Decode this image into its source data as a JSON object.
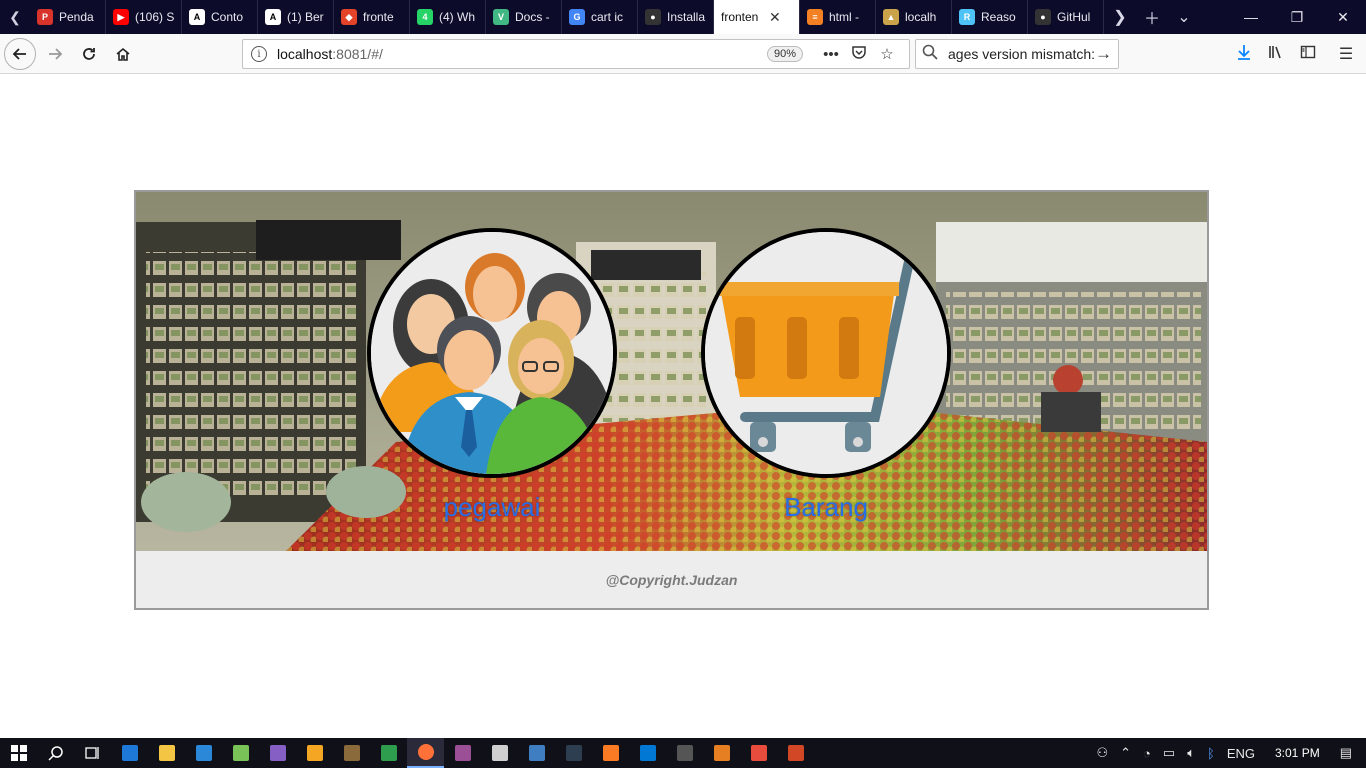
{
  "browser": {
    "tabs": [
      {
        "title": "Penda",
        "icon": "pmb-icon",
        "color": "#d9342b",
        "glyph": "P"
      },
      {
        "title": "(106) S",
        "icon": "youtube-icon",
        "color": "#ff0000",
        "glyph": "▶"
      },
      {
        "title": "Conto",
        "icon": "notion-icon",
        "color": "#ffffff",
        "glyph": "A"
      },
      {
        "title": "(1) Ber",
        "icon": "font-a-icon",
        "color": "#ffffff",
        "glyph": "A"
      },
      {
        "title": "fronte",
        "icon": "gitlab-icon",
        "color": "#e24329",
        "glyph": "◆"
      },
      {
        "title": "(4) Wh",
        "icon": "whatsapp-icon",
        "color": "#25d366",
        "glyph": "4"
      },
      {
        "title": "Docs -",
        "icon": "vue-icon",
        "color": "#41b883",
        "glyph": "V"
      },
      {
        "title": "cart ic",
        "icon": "google-icon",
        "color": "#4285f4",
        "glyph": "G"
      },
      {
        "title": "Installa",
        "icon": "github-icon",
        "color": "#333333",
        "glyph": "●"
      }
    ],
    "active_tab": {
      "title": "fronten",
      "close": "✕"
    },
    "tabs_after": [
      {
        "title": "html -",
        "icon": "stackoverflow-icon",
        "color": "#f48024",
        "glyph": "≡"
      },
      {
        "title": "localh",
        "icon": "localhost-icon",
        "color": "#c9a24a",
        "glyph": "▲"
      },
      {
        "title": "Reaso",
        "icon": "reason-icon",
        "color": "#4fc3f7",
        "glyph": "R"
      },
      {
        "title": "GitHul",
        "icon": "github-icon",
        "color": "#333333",
        "glyph": "●"
      }
    ],
    "url_host": "localhost",
    "url_path": ":8081/#/",
    "zoom": "90%",
    "search_query": "ages version mismatch:"
  },
  "page": {
    "items": [
      {
        "label": "pegawai"
      },
      {
        "label": "Barang"
      }
    ],
    "footer": "@Copyright.Judzan"
  },
  "taskbar": {
    "language": "ENG",
    "time": "3:01 PM",
    "apps": [
      {
        "name": "edge",
        "color": "#1e78d7"
      },
      {
        "name": "explorer",
        "color": "#f4c542"
      },
      {
        "name": "store",
        "color": "#2b88d8"
      },
      {
        "name": "android-studio",
        "color": "#78c257"
      },
      {
        "name": "visual-studio",
        "color": "#865fc5"
      },
      {
        "name": "media-player",
        "color": "#f5a623"
      },
      {
        "name": "app-brown",
        "color": "#8a6a3a"
      },
      {
        "name": "sheets",
        "color": "#2e9e4e"
      },
      {
        "name": "firefox",
        "color": "#ff7139"
      },
      {
        "name": "app-m",
        "color": "#9b4f96"
      },
      {
        "name": "mail",
        "color": "#cfcfcf"
      },
      {
        "name": "virtualbox",
        "color": "#3f7fc1"
      },
      {
        "name": "powershell",
        "color": "#2c3e50"
      },
      {
        "name": "xampp",
        "color": "#fb7a24"
      },
      {
        "name": "vscode",
        "color": "#0078d4"
      },
      {
        "name": "cmd",
        "color": "#555555"
      },
      {
        "name": "app-orange",
        "color": "#e67e22"
      },
      {
        "name": "app-red",
        "color": "#e74c3c"
      },
      {
        "name": "powerpoint",
        "color": "#d24726"
      }
    ]
  }
}
